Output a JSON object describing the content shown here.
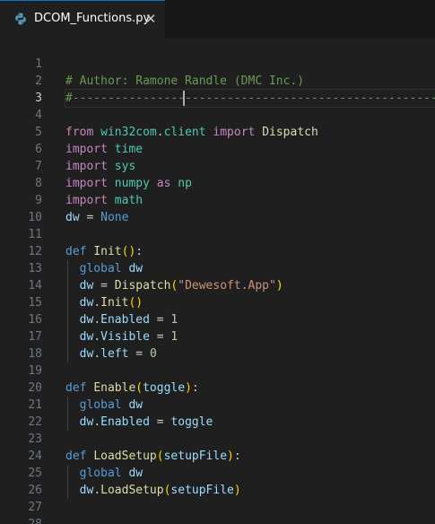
{
  "tab": {
    "label": "DCOM_Functions.py",
    "close_glyph": "✕",
    "icon": "python-icon"
  },
  "editor": {
    "active_line": 3,
    "lines": [
      {
        "num": "1",
        "tokens": []
      },
      {
        "num": "2",
        "tokens": [
          {
            "t": "# Author: Ramone Randle (DMC Inc.)",
            "c": "comment"
          }
        ]
      },
      {
        "num": "3",
        "tokens": [
          {
            "t": "#-----------------------------------------------------------",
            "c": "comment"
          }
        ]
      },
      {
        "num": "4",
        "tokens": []
      },
      {
        "num": "5",
        "tokens": [
          {
            "t": "from",
            "c": "kw"
          },
          {
            "t": " ",
            "c": "plain"
          },
          {
            "t": "win32com",
            "c": "mod"
          },
          {
            "t": ".",
            "c": "plain"
          },
          {
            "t": "client",
            "c": "mod"
          },
          {
            "t": " ",
            "c": "plain"
          },
          {
            "t": "import",
            "c": "kw"
          },
          {
            "t": " ",
            "c": "plain"
          },
          {
            "t": "Dispatch",
            "c": "fn"
          }
        ]
      },
      {
        "num": "6",
        "tokens": [
          {
            "t": "import",
            "c": "kw"
          },
          {
            "t": " ",
            "c": "plain"
          },
          {
            "t": "time",
            "c": "mod"
          }
        ]
      },
      {
        "num": "7",
        "tokens": [
          {
            "t": "import",
            "c": "kw"
          },
          {
            "t": " ",
            "c": "plain"
          },
          {
            "t": "sys",
            "c": "mod"
          }
        ]
      },
      {
        "num": "8",
        "tokens": [
          {
            "t": "import",
            "c": "kw"
          },
          {
            "t": " ",
            "c": "plain"
          },
          {
            "t": "numpy",
            "c": "mod"
          },
          {
            "t": " ",
            "c": "plain"
          },
          {
            "t": "as",
            "c": "kw"
          },
          {
            "t": " ",
            "c": "plain"
          },
          {
            "t": "np",
            "c": "mod"
          }
        ]
      },
      {
        "num": "9",
        "tokens": [
          {
            "t": "import",
            "c": "kw"
          },
          {
            "t": " ",
            "c": "plain"
          },
          {
            "t": "math",
            "c": "mod"
          }
        ]
      },
      {
        "num": "10",
        "tokens": [
          {
            "t": "dw",
            "c": "var"
          },
          {
            "t": " = ",
            "c": "plain"
          },
          {
            "t": "None",
            "c": "const"
          }
        ]
      },
      {
        "num": "11",
        "tokens": []
      },
      {
        "num": "12",
        "tokens": [
          {
            "t": "def",
            "c": "def"
          },
          {
            "t": " ",
            "c": "plain"
          },
          {
            "t": "Init",
            "c": "fn"
          },
          {
            "t": "()",
            "c": "paren"
          },
          {
            "t": ":",
            "c": "plain"
          }
        ]
      },
      {
        "num": "13",
        "guide": true,
        "tokens": [
          {
            "t": "  ",
            "c": "plain"
          },
          {
            "t": "global",
            "c": "def"
          },
          {
            "t": " ",
            "c": "plain"
          },
          {
            "t": "dw",
            "c": "var"
          }
        ]
      },
      {
        "num": "14",
        "guide": true,
        "tokens": [
          {
            "t": "  ",
            "c": "plain"
          },
          {
            "t": "dw",
            "c": "var"
          },
          {
            "t": " = ",
            "c": "plain"
          },
          {
            "t": "Dispatch",
            "c": "fn"
          },
          {
            "t": "(",
            "c": "paren"
          },
          {
            "t": "\"Dewesoft.App\"",
            "c": "str"
          },
          {
            "t": ")",
            "c": "paren"
          }
        ]
      },
      {
        "num": "15",
        "guide": true,
        "tokens": [
          {
            "t": "  ",
            "c": "plain"
          },
          {
            "t": "dw",
            "c": "var"
          },
          {
            "t": ".",
            "c": "plain"
          },
          {
            "t": "Init",
            "c": "fn"
          },
          {
            "t": "()",
            "c": "paren"
          }
        ]
      },
      {
        "num": "16",
        "guide": true,
        "tokens": [
          {
            "t": "  ",
            "c": "plain"
          },
          {
            "t": "dw",
            "c": "var"
          },
          {
            "t": ".",
            "c": "plain"
          },
          {
            "t": "Enabled",
            "c": "var"
          },
          {
            "t": " = ",
            "c": "plain"
          },
          {
            "t": "1",
            "c": "num"
          }
        ]
      },
      {
        "num": "17",
        "guide": true,
        "tokens": [
          {
            "t": "  ",
            "c": "plain"
          },
          {
            "t": "dw",
            "c": "var"
          },
          {
            "t": ".",
            "c": "plain"
          },
          {
            "t": "Visible",
            "c": "var"
          },
          {
            "t": " = ",
            "c": "plain"
          },
          {
            "t": "1",
            "c": "num"
          }
        ]
      },
      {
        "num": "18",
        "guide": true,
        "tokens": [
          {
            "t": "  ",
            "c": "plain"
          },
          {
            "t": "dw",
            "c": "var"
          },
          {
            "t": ".",
            "c": "plain"
          },
          {
            "t": "left",
            "c": "var"
          },
          {
            "t": " = ",
            "c": "plain"
          },
          {
            "t": "0",
            "c": "num"
          }
        ]
      },
      {
        "num": "19",
        "tokens": []
      },
      {
        "num": "20",
        "tokens": [
          {
            "t": "def",
            "c": "def"
          },
          {
            "t": " ",
            "c": "plain"
          },
          {
            "t": "Enable",
            "c": "fn"
          },
          {
            "t": "(",
            "c": "paren"
          },
          {
            "t": "toggle",
            "c": "var"
          },
          {
            "t": ")",
            "c": "paren"
          },
          {
            "t": ":",
            "c": "plain"
          }
        ]
      },
      {
        "num": "21",
        "guide": true,
        "tokens": [
          {
            "t": "  ",
            "c": "plain"
          },
          {
            "t": "global",
            "c": "def"
          },
          {
            "t": " ",
            "c": "plain"
          },
          {
            "t": "dw",
            "c": "var"
          }
        ]
      },
      {
        "num": "22",
        "guide": true,
        "tokens": [
          {
            "t": "  ",
            "c": "plain"
          },
          {
            "t": "dw",
            "c": "var"
          },
          {
            "t": ".",
            "c": "plain"
          },
          {
            "t": "Enabled",
            "c": "var"
          },
          {
            "t": " = ",
            "c": "plain"
          },
          {
            "t": "toggle",
            "c": "var"
          }
        ]
      },
      {
        "num": "23",
        "tokens": []
      },
      {
        "num": "24",
        "tokens": [
          {
            "t": "def",
            "c": "def"
          },
          {
            "t": " ",
            "c": "plain"
          },
          {
            "t": "LoadSetup",
            "c": "fn"
          },
          {
            "t": "(",
            "c": "paren"
          },
          {
            "t": "setupFile",
            "c": "var"
          },
          {
            "t": ")",
            "c": "paren"
          },
          {
            "t": ":",
            "c": "plain"
          }
        ]
      },
      {
        "num": "25",
        "guide": true,
        "tokens": [
          {
            "t": "  ",
            "c": "plain"
          },
          {
            "t": "global",
            "c": "def"
          },
          {
            "t": " ",
            "c": "plain"
          },
          {
            "t": "dw",
            "c": "var"
          }
        ]
      },
      {
        "num": "26",
        "guide": true,
        "tokens": [
          {
            "t": "  ",
            "c": "plain"
          },
          {
            "t": "dw",
            "c": "var"
          },
          {
            "t": ".",
            "c": "plain"
          },
          {
            "t": "LoadSetup",
            "c": "fn"
          },
          {
            "t": "(",
            "c": "paren"
          },
          {
            "t": "setupFile",
            "c": "var"
          },
          {
            "t": ")",
            "c": "paren"
          }
        ]
      },
      {
        "num": "27",
        "tokens": []
      },
      {
        "num": "28",
        "tokens": []
      }
    ]
  },
  "colors": {
    "background": "#1f1f1f",
    "tabbar": "#181818",
    "accent": "#0078d4",
    "comment": "#6a9955",
    "keyword": "#c586c0",
    "function": "#dcdcaa",
    "module": "#4ec9b0",
    "variable": "#9cdcfe",
    "string": "#ce9178",
    "number": "#b5cea8"
  }
}
